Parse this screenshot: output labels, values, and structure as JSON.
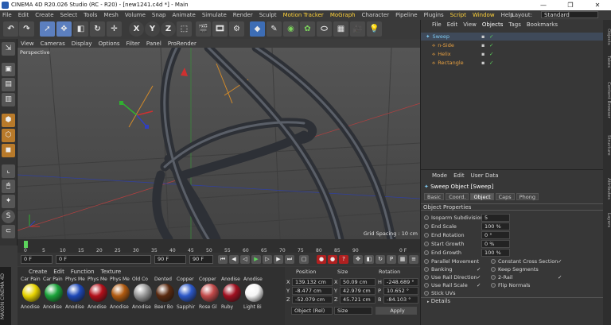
{
  "window": {
    "title": "CINEMA 4D R20.026 Studio (RC - R20) - [new1241.c4d *] - Main",
    "minimize": "—",
    "restore": "❐",
    "close": "✕"
  },
  "menu": {
    "items": [
      "File",
      "Edit",
      "Create",
      "Select",
      "Tools",
      "Mesh",
      "Volume",
      "Snap",
      "Animate",
      "Simulate",
      "Render",
      "Sculpt",
      "Motion Tracker",
      "MoGraph",
      "Character",
      "Pipeline",
      "Plugins",
      "Script",
      "Window",
      "Help"
    ],
    "layout_label": "Layout:",
    "layout_value": "Standard"
  },
  "toolbar": {
    "undo": "↶",
    "axes": [
      "X",
      "Y",
      "Z"
    ]
  },
  "viewport": {
    "menu": [
      "View",
      "Cameras",
      "Display",
      "Options",
      "Filter",
      "Panel",
      "ProRender"
    ],
    "camera_label": "Perspective",
    "grid_spacing": "Grid Spacing : 10 cm"
  },
  "timeline": {
    "ticks": [
      "0",
      "5",
      "10",
      "15",
      "20",
      "25",
      "30",
      "35",
      "40",
      "45",
      "50",
      "55",
      "60",
      "65",
      "70",
      "75",
      "80",
      "85",
      "90"
    ],
    "end_marker": "0 F",
    "start_frame": "0 F",
    "current_frame": "0 F",
    "end_range": "90 F",
    "end_frame": "90 F"
  },
  "materials": {
    "menu": [
      "Create",
      "Edit",
      "Function",
      "Texture"
    ],
    "items": [
      {
        "top": "Car Pain",
        "bottom": "Anodise",
        "color": "#e7d300"
      },
      {
        "top": "Car Pain",
        "bottom": "Anodise",
        "color": "#1aa33a"
      },
      {
        "top": "Phys Me",
        "bottom": "Anodise",
        "color": "#1d48b8"
      },
      {
        "top": "Phys Me",
        "bottom": "Anodise",
        "color": "#b3101a"
      },
      {
        "top": "Phys Me",
        "bottom": "Anodise",
        "color": "#b05a10"
      },
      {
        "top": "Old Co",
        "bottom": "Anodise",
        "color": "#999999"
      },
      {
        "top": "Dented",
        "bottom": "Beer Bo",
        "color": "#5a2a10"
      },
      {
        "top": "Copper",
        "bottom": "Sapphir",
        "color": "#2c58c8"
      },
      {
        "top": "Copper",
        "bottom": "Rose Gl",
        "color": "#c24a4a"
      },
      {
        "top": "Anodise",
        "bottom": "Ruby",
        "color": "#a01020"
      },
      {
        "top": "Anodise",
        "bottom": "Light Bi",
        "color": "#f4f4f4"
      }
    ]
  },
  "coordinates": {
    "headers": [
      "Position",
      "Size",
      "Rotation"
    ],
    "rows": [
      {
        "axis": "X",
        "pos": "139.132 cm",
        "size_axis": "X",
        "size": "50.09 cm",
        "rot_axis": "H",
        "rot": "-248.689 °"
      },
      {
        "axis": "Y",
        "pos": "-8.477 cm",
        "size_axis": "Y",
        "size": "42.979 cm",
        "rot_axis": "P",
        "rot": "10.652 °"
      },
      {
        "axis": "Z",
        "pos": "-52.079 cm",
        "size_axis": "Z",
        "size": "45.721 cm",
        "rot_axis": "B",
        "rot": "-84.103 °"
      }
    ],
    "mode": "Object (Rel)",
    "size_mode": "Size",
    "apply": "Apply"
  },
  "objects": {
    "menu": [
      "File",
      "Edit",
      "View",
      "Objects",
      "Tags",
      "Bookmarks"
    ],
    "tree": [
      {
        "name": "Sweep",
        "color": "#7ec8f0"
      },
      {
        "name": "n-Side",
        "color": "#e8a040"
      },
      {
        "name": "Helix",
        "color": "#e8a040"
      },
      {
        "name": "Rectangle",
        "color": "#e8a040"
      }
    ]
  },
  "attributes": {
    "menu": [
      "Mode",
      "Edit",
      "User Data"
    ],
    "object_title": "Sweep Object [Sweep]",
    "tabs": [
      "Basic",
      "Coord.",
      "Object",
      "Caps",
      "Phong"
    ],
    "section": "Object Properties",
    "fields": [
      {
        "label": "Isoparm Subdivision",
        "value": "5"
      },
      {
        "label": "End Scale",
        "value": "100 %"
      },
      {
        "label": "End Rotation",
        "value": "0 °"
      },
      {
        "label": "Start Growth",
        "value": "0 %"
      },
      {
        "label": "End Growth",
        "value": "100 %"
      }
    ],
    "checks_left": [
      {
        "label": "Parallel Movement",
        "checked": false
      },
      {
        "label": "Banking",
        "checked": true
      },
      {
        "label": "Use Rail Direction",
        "checked": true
      },
      {
        "label": "Use Rail Scale",
        "checked": true
      },
      {
        "label": "Stick UVs",
        "checked": false
      }
    ],
    "checks_right": [
      {
        "label": "Constant Cross Section",
        "checked": true
      },
      {
        "label": "Keep Segments",
        "checked": false
      },
      {
        "label": "2-Rail",
        "checked": true
      },
      {
        "label": "Flip Normals",
        "checked": false
      }
    ],
    "details": "Details"
  },
  "right_tabs": [
    "Objects",
    "Takes",
    "Content Browser",
    "Structure",
    "Attributes",
    "Layers"
  ],
  "brand": {
    "line1": "MAXON",
    "line2": "CINEMA 4D"
  }
}
